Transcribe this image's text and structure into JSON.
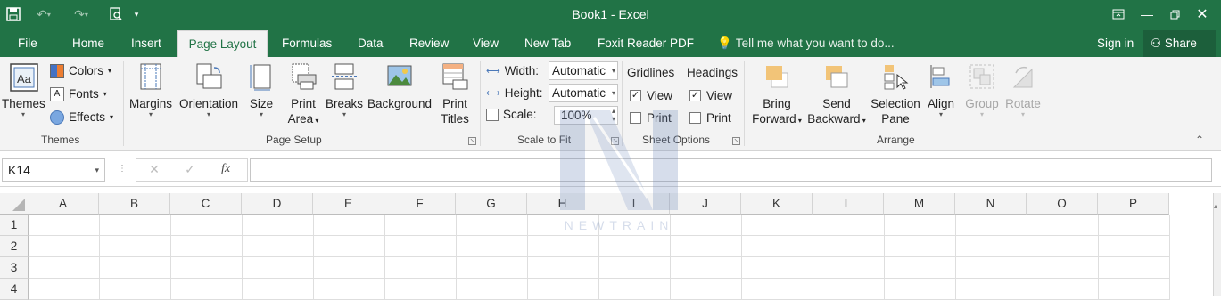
{
  "title": "Book1 - Excel",
  "tabs": [
    "File",
    "Home",
    "Insert",
    "Page Layout",
    "Formulas",
    "Data",
    "Review",
    "View",
    "New Tab",
    "Foxit Reader PDF"
  ],
  "active_tab": "Page Layout",
  "tell_me": "Tell me what you want to do...",
  "sign_in": "Sign in",
  "share": "Share",
  "ribbon": {
    "themes": {
      "big": "Themes",
      "colors": "Colors",
      "fonts": "Fonts",
      "effects": "Effects",
      "label": "Themes"
    },
    "page_setup": {
      "margins": "Margins",
      "orientation": "Orientation",
      "size": "Size",
      "print_area_1": "Print",
      "print_area_2": "Area",
      "breaks": "Breaks",
      "background": "Background",
      "print_titles_1": "Print",
      "print_titles_2": "Titles",
      "label": "Page Setup"
    },
    "scale": {
      "width_label": "Width:",
      "width_value": "Automatic",
      "height_label": "Height:",
      "height_value": "Automatic",
      "scale_label": "Scale:",
      "scale_value": "100%",
      "label": "Scale to Fit"
    },
    "sheet_options": {
      "gridlines": "Gridlines",
      "headings": "Headings",
      "view": "View",
      "print": "Print",
      "label": "Sheet Options",
      "gridlines_view": true,
      "gridlines_print": false,
      "headings_view": true,
      "headings_print": false
    },
    "arrange": {
      "bring_1": "Bring",
      "bring_2": "Forward",
      "send_1": "Send",
      "send_2": "Backward",
      "selection_1": "Selection",
      "selection_2": "Pane",
      "align": "Align",
      "group": "Group",
      "rotate": "Rotate",
      "label": "Arrange"
    }
  },
  "formula_bar": {
    "name_box": "K14",
    "fx": "fx",
    "formula": ""
  },
  "columns": [
    "A",
    "B",
    "C",
    "D",
    "E",
    "F",
    "G",
    "H",
    "I",
    "J",
    "K",
    "L",
    "M",
    "N",
    "O",
    "P"
  ],
  "rows": [
    "1",
    "2",
    "3",
    "4"
  ],
  "watermark_text": "NEWTRAIN",
  "colors": {
    "accent": "#217346",
    "ribbon_bg": "#f3f3f3",
    "share_bg": "#1c5f3b"
  }
}
